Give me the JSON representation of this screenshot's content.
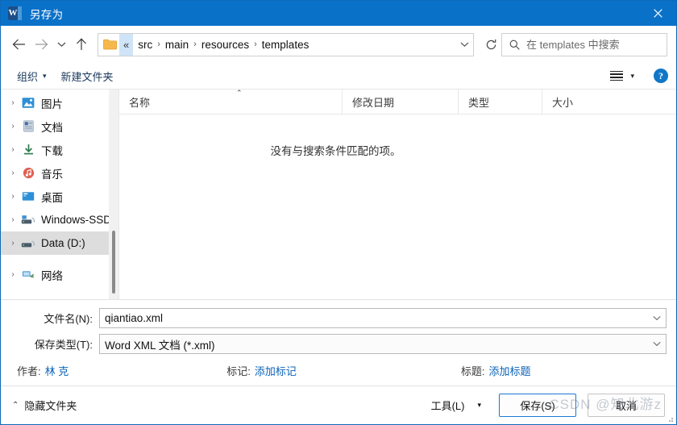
{
  "window": {
    "title": "另存为",
    "app_icon": "word-icon",
    "app_icon_letter": "W",
    "close_label": "✕"
  },
  "navbar": {
    "back_icon": "back-arrow-icon",
    "forward_icon": "forward-arrow-icon",
    "recent_icon": "chevron-down-icon",
    "up_icon": "up-arrow-icon",
    "folder_icon": "folder-icon",
    "overflow_label": "«",
    "crumbs": [
      "src",
      "main",
      "resources",
      "templates"
    ],
    "separator": "›",
    "address_dropdown_icon": "chevron-down-icon",
    "refresh_icon": "refresh-icon"
  },
  "search": {
    "icon": "search-icon",
    "placeholder": "在 templates 中搜索",
    "value": ""
  },
  "commandbar": {
    "organize_label": "组织",
    "organize_caret": "▾",
    "new_folder_label": "新建文件夹",
    "view_icon": "view-list-icon",
    "view_caret": "▾",
    "help_label": "?"
  },
  "sidebar": {
    "items": [
      {
        "label": "图片",
        "icon": "pictures-icon",
        "chevron": "›",
        "selected": false
      },
      {
        "label": "文档",
        "icon": "documents-icon",
        "chevron": "›",
        "selected": false
      },
      {
        "label": "下载",
        "icon": "downloads-icon",
        "chevron": "›",
        "selected": false
      },
      {
        "label": "音乐",
        "icon": "music-icon",
        "chevron": "›",
        "selected": false
      },
      {
        "label": "桌面",
        "icon": "desktop-icon",
        "chevron": "›",
        "selected": false
      },
      {
        "label": "Windows-SSD",
        "icon": "drive-icon",
        "chevron": "›",
        "selected": false
      },
      {
        "label": "Data (D:)",
        "icon": "drive-icon",
        "chevron": "›",
        "selected": true
      },
      {
        "label": "网络",
        "icon": "network-icon",
        "chevron": "›",
        "selected": false
      }
    ]
  },
  "filelist": {
    "columns": [
      {
        "label": "名称",
        "sorted": "asc",
        "sort_caret": "⌃"
      },
      {
        "label": "修改日期",
        "sorted": ""
      },
      {
        "label": "类型",
        "sorted": ""
      },
      {
        "label": "大小",
        "sorted": ""
      }
    ],
    "rows": [],
    "empty_message": "没有与搜索条件匹配的项。"
  },
  "form": {
    "filename_label": "文件名(N):",
    "filename_value": "qiantiao.xml",
    "filetype_label": "保存类型(T):",
    "filetype_value": "Word XML 文档 (*.xml)",
    "dropdown_icon": "chevron-down-icon"
  },
  "metadata": {
    "author_key": "作者:",
    "author_value": "林 克",
    "tags_key": "标记:",
    "tags_value": "添加标记",
    "title_key": "标题:",
    "title_value": "添加标题"
  },
  "footer": {
    "hide_folders_caret": "⌃",
    "hide_folders_label": "隐藏文件夹",
    "tools_label": "工具(L)",
    "tools_caret": "▾",
    "save_label": "保存(S)",
    "cancel_label": "取消"
  },
  "watermark": {
    "text": "CSDN @知北游z"
  },
  "colors": {
    "titlebar": "#0a71c8",
    "accent": "#1a7ad4",
    "link": "#0a62b8",
    "selection": "#dddddd",
    "crumb_highlight": "#cfe4f7"
  }
}
